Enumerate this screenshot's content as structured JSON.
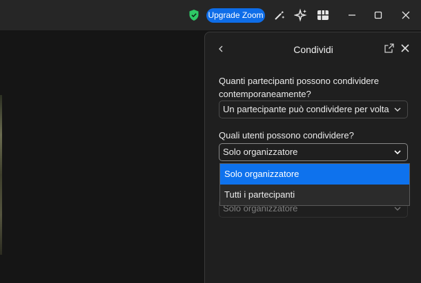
{
  "header": {
    "upgrade_label": "Upgrade Zoom"
  },
  "panel": {
    "title": "Condividi",
    "q1_label": "Quanti partecipanti possono condividere contemporaneamente?",
    "q1_value": "Un partecipante può condividere per volta",
    "q2_label": "Quali utenti possono condividere?",
    "q2_value": "Solo organizzatore",
    "q3_value": "Solo organizzatore"
  },
  "dropdown": {
    "options": [
      "Solo organizzatore",
      "Tutti i partecipanti"
    ],
    "selected": "Solo organizzatore"
  },
  "colors": {
    "accent": "#0e72ed",
    "shield": "#2ec866",
    "panel_bg": "#1f1f1f",
    "titlebar_bg": "#262626"
  }
}
